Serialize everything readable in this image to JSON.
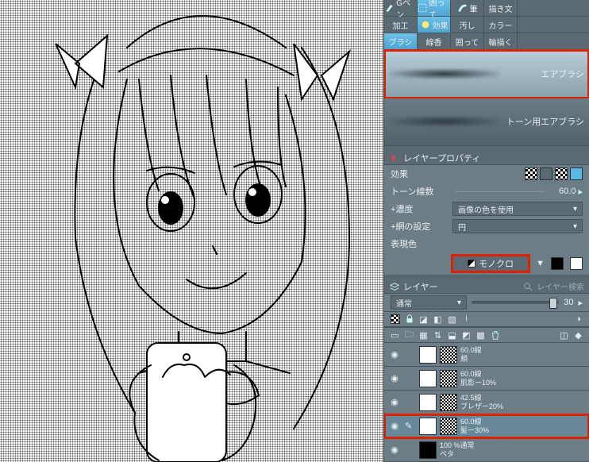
{
  "toolrows": [
    [
      {
        "label": "Gペン",
        "sel": false
      },
      {
        "label": "囲って",
        "sel": true
      },
      {
        "label": "筆",
        "sel": false
      },
      {
        "label": "描き文",
        "sel": false
      }
    ],
    [
      {
        "label": "加工",
        "sel": false
      },
      {
        "label": "効果",
        "sel": true
      },
      {
        "label": "汚し",
        "sel": false
      },
      {
        "label": "カラー",
        "sel": false
      }
    ],
    [
      {
        "label": "ブラシ",
        "sel": true
      },
      {
        "label": "線香",
        "sel": false
      },
      {
        "label": "囲って",
        "sel": false
      },
      {
        "label": "輪描く",
        "sel": false
      }
    ]
  ],
  "brushes": [
    {
      "name": "エアブラシ",
      "highlight": true
    },
    {
      "name": "トーン用エアブラシ",
      "highlight": false
    }
  ],
  "propTitle": "レイヤープロパティ",
  "effect_label": "効果",
  "props": {
    "tone_lines": {
      "label": "トーン線数",
      "value": "60.0"
    },
    "density": {
      "label": "+濃度",
      "value": "画像の色を使用"
    },
    "net": {
      "label": "+網の設定",
      "value": "円"
    },
    "color": {
      "label": "表現色"
    }
  },
  "mono": {
    "label": "モノクロ",
    "arrow": "▼"
  },
  "layer_section": "レイヤー",
  "layer_search": "レイヤー検索",
  "blend": {
    "mode": "通常",
    "opacity": "30"
  },
  "layers": [
    {
      "name": "60.0線",
      "sub": "頬",
      "sel": false
    },
    {
      "name": "60.0線",
      "sub": "肌影ー10%",
      "sel": false
    },
    {
      "name": "42.5線",
      "sub": "ブレザー20%",
      "sel": false
    },
    {
      "name": "60.0線",
      "sub": "髪ー30%",
      "sel": true
    },
    {
      "name": "100 %通常",
      "sub": "ベタ",
      "sel": false
    }
  ],
  "icons": {
    "eye": "◉",
    "brush": "✎",
    "expand": "▸",
    "collapse": "▾",
    "dropdown": "▼"
  }
}
